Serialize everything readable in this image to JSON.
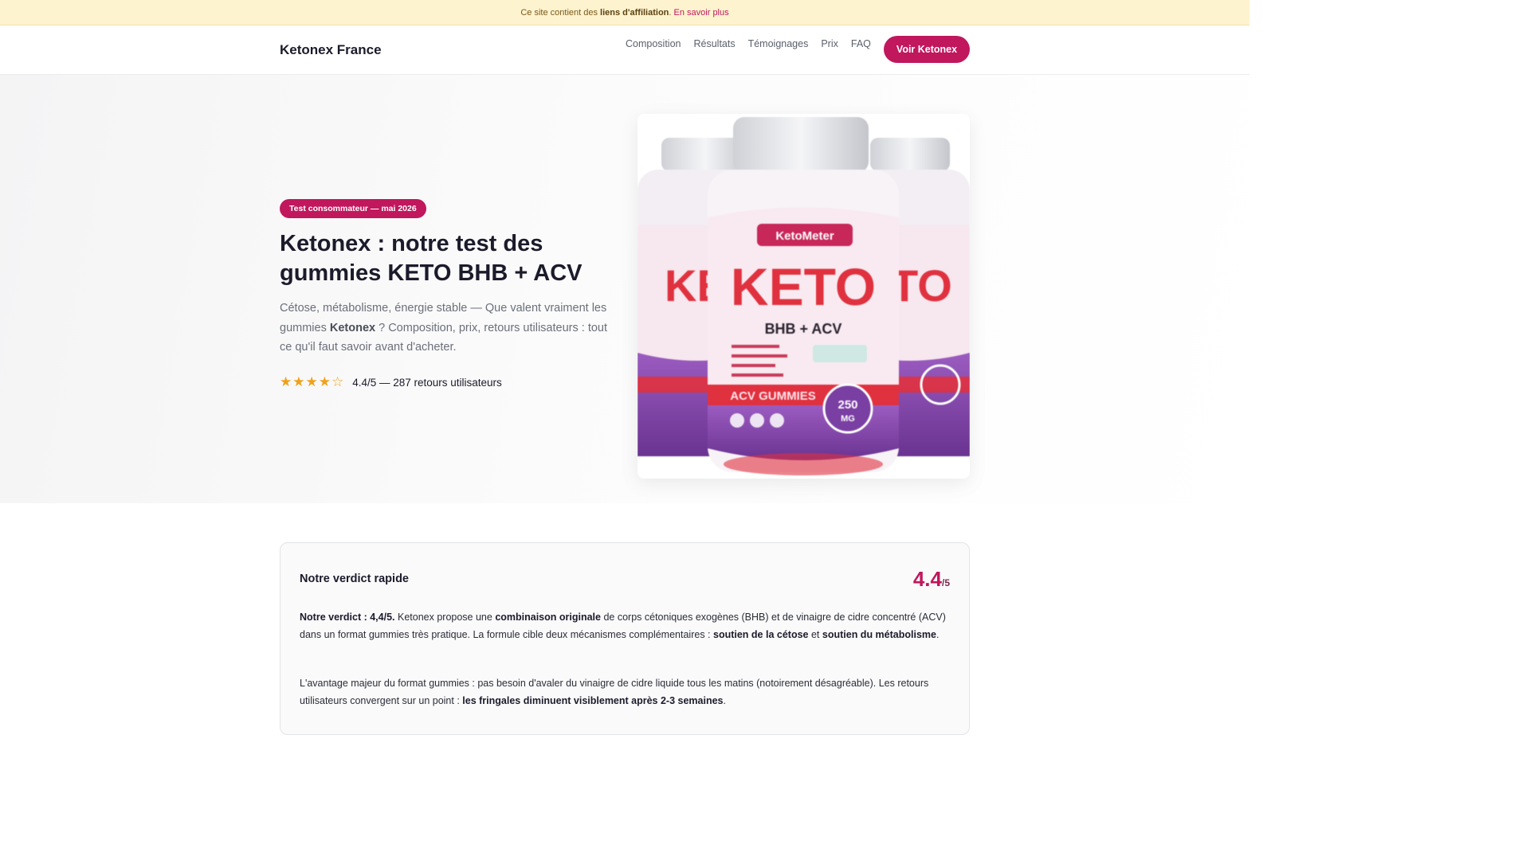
{
  "banner": {
    "prefix": "Ce site contient des",
    "bold": "liens d'affiliation",
    "link": "En savoir plus"
  },
  "nav": {
    "brand": "Ketonex France",
    "items": [
      "Composition",
      "Résultats",
      "Témoignages",
      "Prix",
      "FAQ"
    ],
    "cta": "Voir Ketonex"
  },
  "hero": {
    "badge": "Test consommateur — mai 2026",
    "title": "Ketonex : notre test des gummies KETO BHB + ACV",
    "lead_1": "Cétose, métabolisme, énergie stable — Que valent vraiment les gummies",
    "lead_bold": "Ketonex",
    "lead_2": "? Composition, prix, retours utilisateurs : tout ce qu'il faut savoir avant d'acheter.",
    "stars": "★★★★☆",
    "rating_text": "4.4/5 — 287 retours utilisateurs",
    "rating_value": 4.4,
    "product": {
      "brand_label": "KetoMeter",
      "main_label": "KETO",
      "sub_label": "BHB + ACV",
      "band_label": "ACV GUMMIES",
      "dose": "250",
      "dose_unit": "MG"
    }
  },
  "verdict": {
    "title": "Notre verdict rapide",
    "score": "4.4",
    "score_max": "/5",
    "p1": {
      "b1": "Notre verdict : 4,4/5.",
      "t1": "Ketonex propose une",
      "b2": "combinaison originale",
      "t2": "de corps cétoniques exogènes (BHB) et de vinaigre de cidre concentré (ACV) dans un format gummies très pratique. La formule cible deux mécanismes complémentaires :",
      "b3": "soutien de la cétose",
      "t3": "et",
      "b4": "soutien du métabolisme",
      "t4": "."
    },
    "p2": {
      "t1": "L'avantage majeur du format gummies : pas besoin d'avaler du vinaigre de cidre liquide tous les matins (notoirement désagréable). Les retours utilisateurs convergent sur un point :",
      "b1": "les fringales diminuent visiblement après 2-3 semaines",
      "t2": "."
    }
  },
  "colors": {
    "accent": "#c0175d",
    "banner_bg": "#fdf3cf",
    "star": "#f0a11a",
    "jar_purple": "#8a4fb0",
    "jar_red": "#e0313f"
  }
}
